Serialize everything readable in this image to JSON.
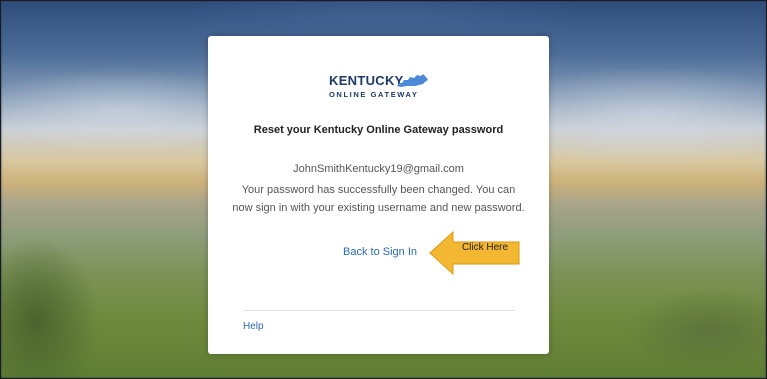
{
  "logo": {
    "line1": "KENTUCKY",
    "line2": "ONLINE GATEWAY"
  },
  "heading": "Reset your Kentucky Online Gateway password",
  "email": "JohnSmithKentucky19@gmail.com",
  "message": {
    "line1": "Your password has successfully been changed. You can",
    "line2": "now sign in with your existing username and new password."
  },
  "back_link": "Back to Sign In",
  "callout": {
    "label": "Click Here",
    "color": "#f4b731"
  },
  "help_link": "Help",
  "colors": {
    "link": "#2b6cb0",
    "logo": "#1b3a66",
    "logo_state": "#4a8ad6"
  }
}
